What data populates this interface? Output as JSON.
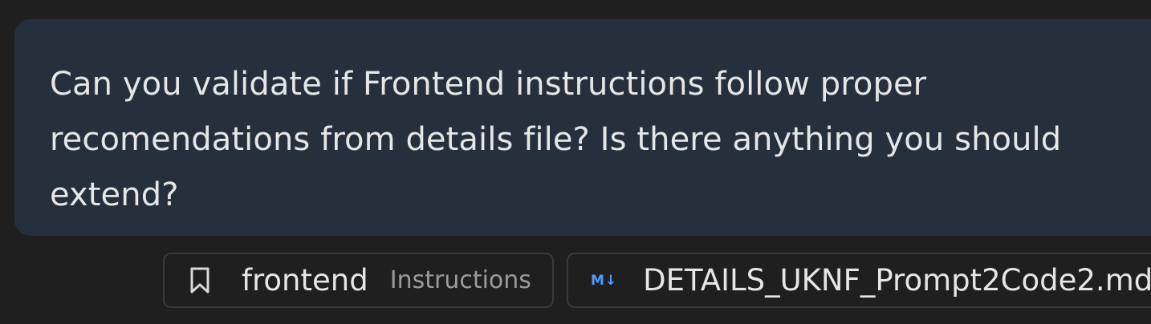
{
  "message": {
    "text": "Can you validate if Frontend instructions follow proper recomendations from details file? Is there anything you should extend?"
  },
  "attachments": [
    {
      "icon": "bookmark-icon",
      "name": "frontend",
      "kind": "Instructions"
    },
    {
      "icon": "markdown-icon",
      "icon_text": "M↓",
      "name": "DETAILS_UKNF_Prompt2Code2.md"
    }
  ],
  "colors": {
    "background": "#1f1f1f",
    "bubble": "#25303c",
    "markdown_icon": "#4d9cff"
  }
}
